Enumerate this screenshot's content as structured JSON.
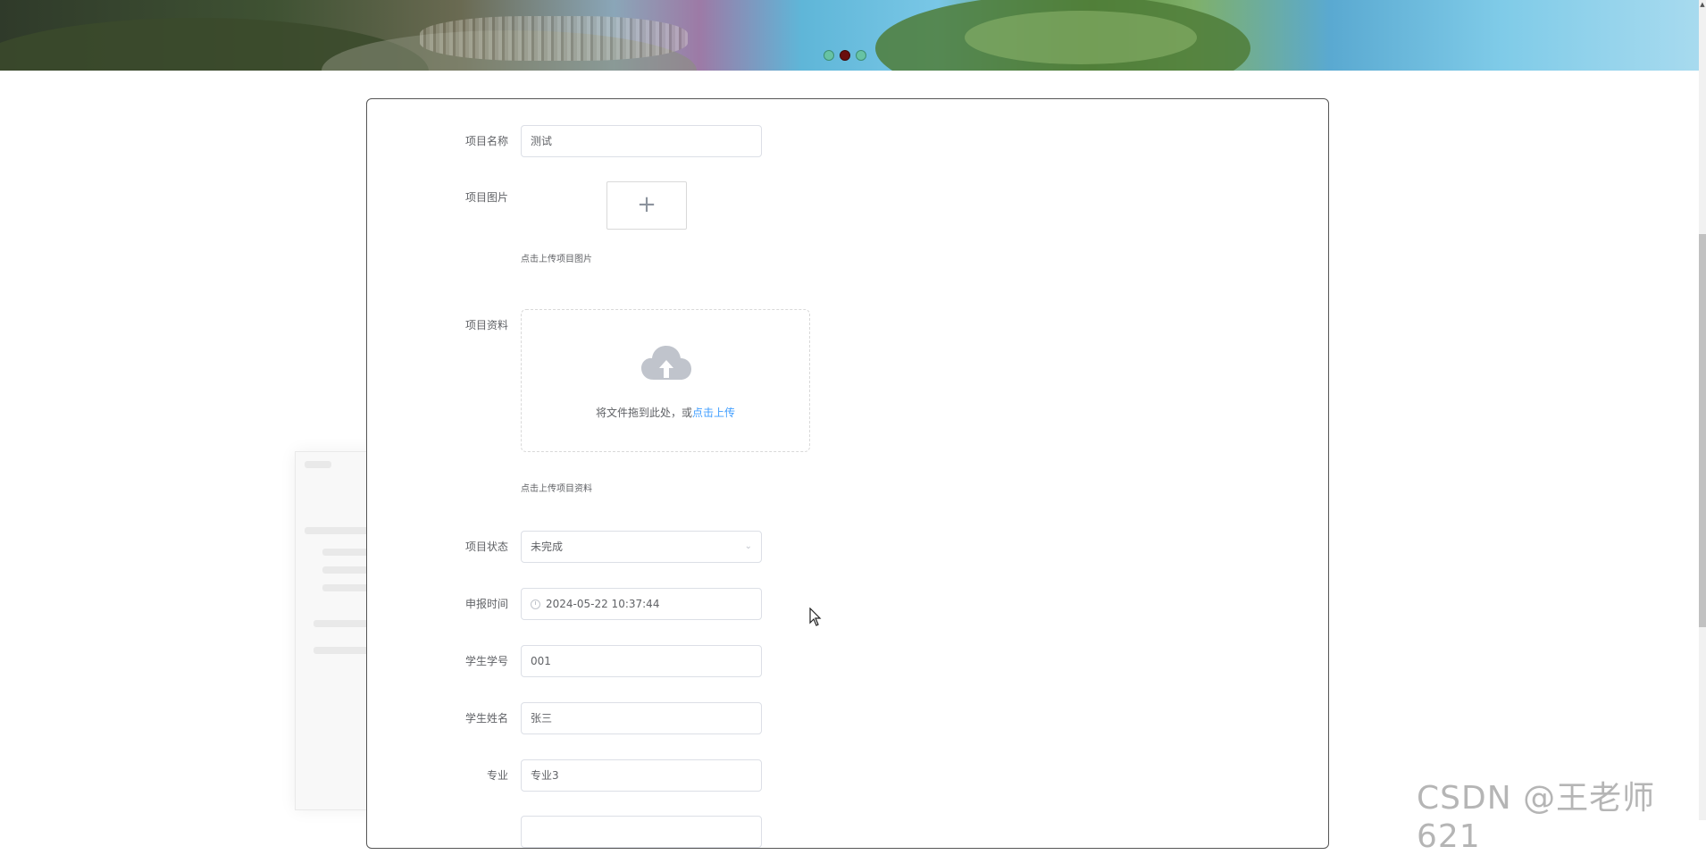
{
  "banner": {
    "slide_count": 3,
    "active_slide": 2
  },
  "form": {
    "project_name": {
      "label": "项目名称",
      "value": "测试"
    },
    "project_image": {
      "label": "项目图片",
      "plus": "+",
      "tip": "点击上传项目图片"
    },
    "project_file": {
      "label": "项目资料",
      "drag_text": "将文件拖到此处，或",
      "drag_link": "点击上传",
      "tip": "点击上传项目资料"
    },
    "project_status": {
      "label": "项目状态",
      "value": "未完成"
    },
    "report_time": {
      "label": "申报时间",
      "value": "2024-05-22 10:37:44"
    },
    "student_id": {
      "label": "学生学号",
      "value": "001"
    },
    "student_name": {
      "label": "学生姓名",
      "value": "张三"
    },
    "major": {
      "label": "专业",
      "value": "专业3"
    }
  },
  "watermark": "CSDN @王老师621",
  "colors": {
    "link": "#409eff",
    "dot_active": "#6a0d0d",
    "dot": "#67c3a4"
  }
}
